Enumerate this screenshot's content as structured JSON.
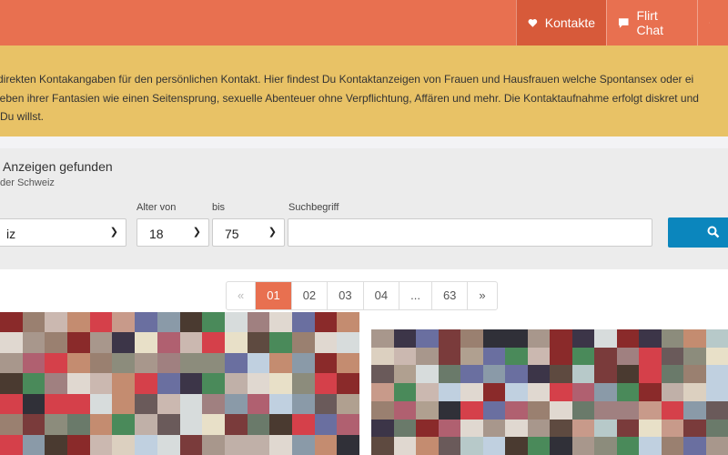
{
  "header": {
    "nav": [
      {
        "label": "Kontakte",
        "icon": "heart-icon",
        "active": true
      },
      {
        "label": "Flirt Chat",
        "icon": "chat-bubble-icon",
        "active": false
      }
    ],
    "edit_icon": "pencil-icon",
    "color": "#e87050"
  },
  "intro": {
    "lines": [
      "direkten Kontakangaben für den persönlichen Kontakt. Hier findest Du Kontaktanzeigen von Frauen und Hausfrauen welche Spontansex oder ei",
      "leben ihrer Fantasien wie einen Seitensprung, sexuelle Abenteuer ohne Verpflichtung, Affären und mehr. Die Kontaktaufnahme erfolgt diskret und",
      "Du willst."
    ],
    "color": "#e8c266"
  },
  "search": {
    "count_text": "Anzeigen gefunden",
    "region_text": "der Schweiz",
    "region_value": "iz",
    "age_from_label": "Alter von",
    "age_from": "18",
    "age_to_label": "bis",
    "age_to": "75",
    "term_label": "Suchbegriff",
    "term_value": "",
    "search_icon": "magnifier-icon"
  },
  "pagination": {
    "items": [
      "«",
      "01",
      "02",
      "03",
      "04",
      "...",
      "63",
      "»"
    ],
    "current": "01"
  }
}
